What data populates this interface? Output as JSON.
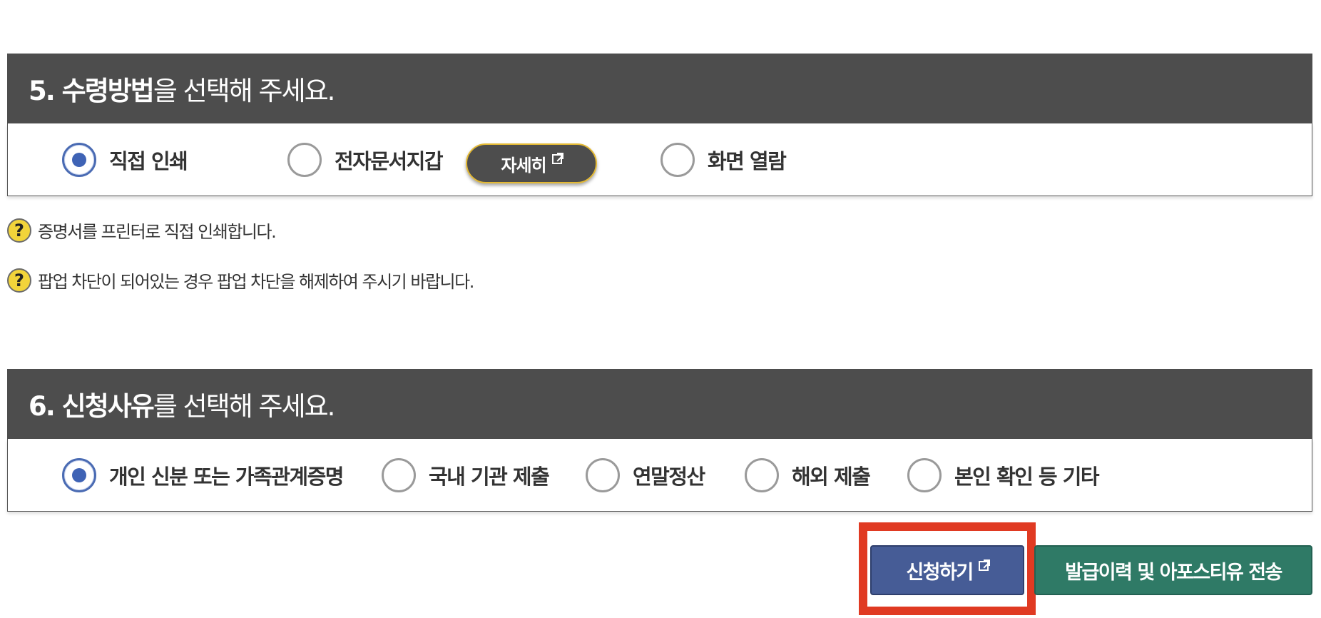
{
  "section5": {
    "title_strong": "5. 수령방법",
    "title_rest": "을 선택해 주세요.",
    "options": [
      {
        "label": "직접 인쇄",
        "checked": true
      },
      {
        "label": "전자문서지갑",
        "checked": false
      },
      {
        "label": "화면 열람",
        "checked": false
      }
    ],
    "detail_button": "자세히",
    "help": [
      "증명서를 프린터로 직접 인쇄합니다.",
      "팝업 차단이 되어있는 경우 팝업 차단을 해제하여 주시기 바랍니다."
    ]
  },
  "section6": {
    "title_strong": "6. 신청사유",
    "title_rest": "를 선택해 주세요.",
    "options": [
      {
        "label": "개인 신분 또는 가족관계증명",
        "checked": true
      },
      {
        "label": "국내 기관 제출",
        "checked": false
      },
      {
        "label": "연말정산",
        "checked": false
      },
      {
        "label": "해외 제출",
        "checked": false
      },
      {
        "label": "본인 확인 등 기타",
        "checked": false
      }
    ]
  },
  "actions": {
    "apply_label": "신청하기",
    "send_label": "발급이력 및 아포스티유 전송"
  },
  "colors": {
    "header_bg": "#4d4d4d",
    "radio_checked": "#3f63b5",
    "apply_bg": "#465c96",
    "send_bg": "#2f7a66",
    "highlight": "#e03a22",
    "help_icon": "#f2d43a"
  },
  "icons": {
    "external_link": "external-link-icon",
    "help": "question-mark-icon"
  }
}
